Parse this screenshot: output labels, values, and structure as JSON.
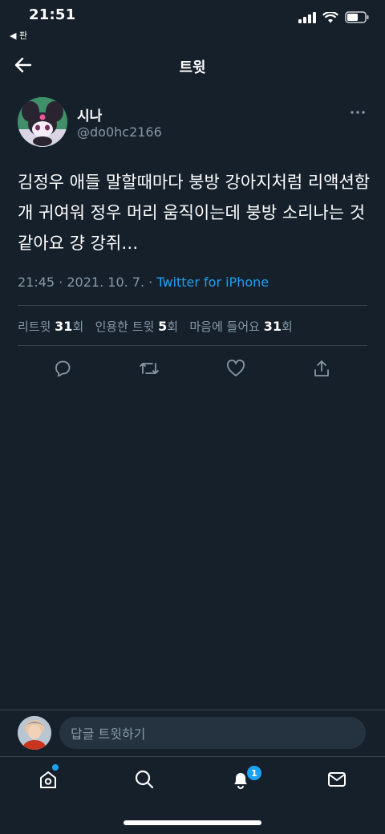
{
  "status_bar": {
    "time": "21:51",
    "back_app": "◀ 판"
  },
  "header": {
    "title": "트윗"
  },
  "tweet": {
    "display_name": "시나",
    "handle": "@do0hc2166",
    "text": "김정우 애들 말할때마다 붕방 강아지처럼 리액션함 개 귀여워 정우 머리 움직이는데 붕방 소리나는 것 같아요 걍 강쥐…",
    "timestamp": "21:45 · 2021. 10. 7. · ",
    "source": "Twitter for iPhone"
  },
  "stats": {
    "retweets_label": "리트윗 ",
    "retweets_count": "31",
    "retweets_suffix": "회",
    "quotes_label": "인용한 트윗 ",
    "quotes_count": "5",
    "quotes_suffix": "회",
    "likes_label": "마음에 들어요 ",
    "likes_count": "31",
    "likes_suffix": "회"
  },
  "reply": {
    "placeholder": "답글 트윗하기"
  },
  "tab_bar": {
    "notifications_badge": "1"
  },
  "colors": {
    "background": "#15202b",
    "accent": "#1da1f2",
    "muted": "#8899a6",
    "divider": "#38444d"
  }
}
